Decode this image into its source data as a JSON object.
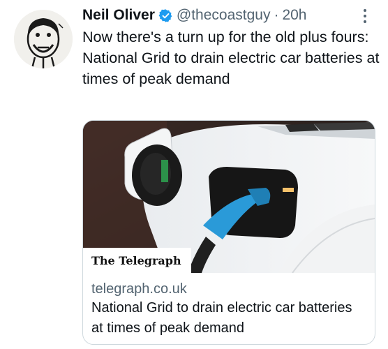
{
  "tweet": {
    "author_name": "Neil Oliver",
    "handle": "@thecoastguy",
    "separator": "·",
    "time": "20h",
    "text_lines": [
      "Now there's a turn up for the old plus fours:",
      "National Grid to drain electric car batteries at times of peak demand"
    ]
  },
  "card": {
    "source_label": "The Telegraph",
    "domain": "telegraph.co.uk",
    "title": "National Grid to drain electric car batteries at times of peak demand"
  },
  "colors": {
    "verified_badge": "#1d9bf0",
    "secondary_text": "#536471",
    "card_border": "#cfd9de",
    "plug_blue": "#2a9ad8"
  },
  "icons": {
    "verified": "verified-badge-icon",
    "more": "more-options-icon"
  }
}
